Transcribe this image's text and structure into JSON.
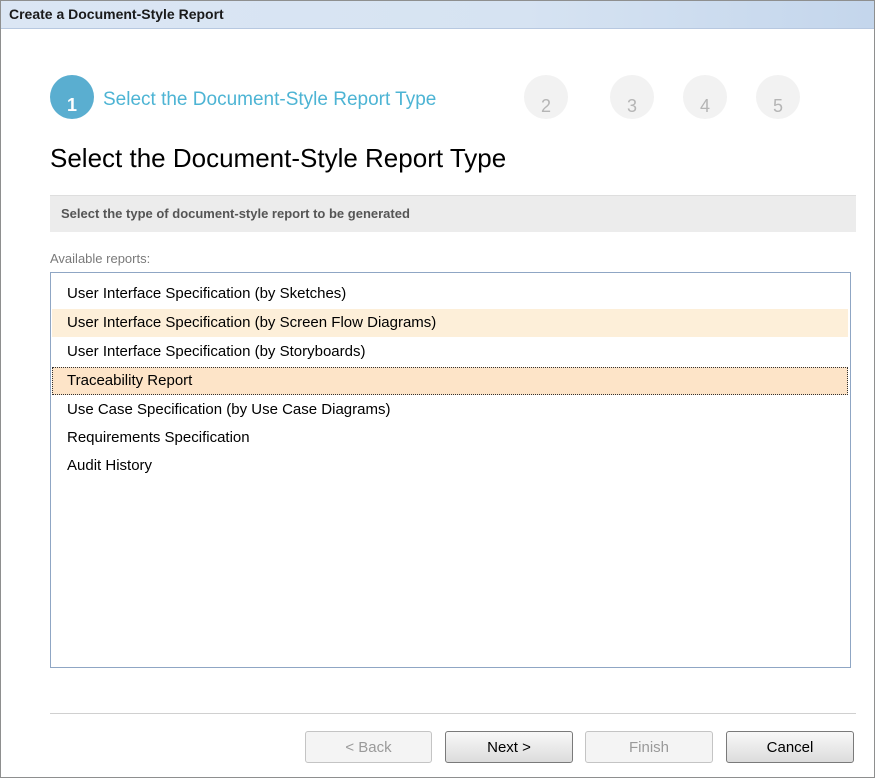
{
  "window": {
    "title": "Create a Document-Style Report"
  },
  "wizard": {
    "active_step": "1",
    "active_label": "Select the Document-Style Report Type",
    "inactive_steps": [
      "2",
      "3",
      "4",
      "5"
    ]
  },
  "page": {
    "title": "Select the Document-Style Report Type",
    "description": "Select the type of document-style report to be generated"
  },
  "reports": {
    "label": "Available reports:",
    "items": [
      "User Interface Specification (by Sketches)",
      "User Interface Specification (by Screen Flow Diagrams)",
      "User Interface Specification (by Storyboards)",
      "Traceability Report",
      "Use Case Specification (by Use Case Diagrams)",
      "Requirements Specification",
      "Audit History"
    ],
    "hovered_item": "User Interface Specification (by Screen Flow Diagrams)",
    "selected_item": "Traceability Report"
  },
  "buttons": {
    "back": "< Back",
    "next": "Next >",
    "finish": "Finish",
    "cancel": "Cancel"
  },
  "colors": {
    "accent": "#5aaed0",
    "selection": "#fde4c8",
    "hover": "#fdefd9"
  }
}
